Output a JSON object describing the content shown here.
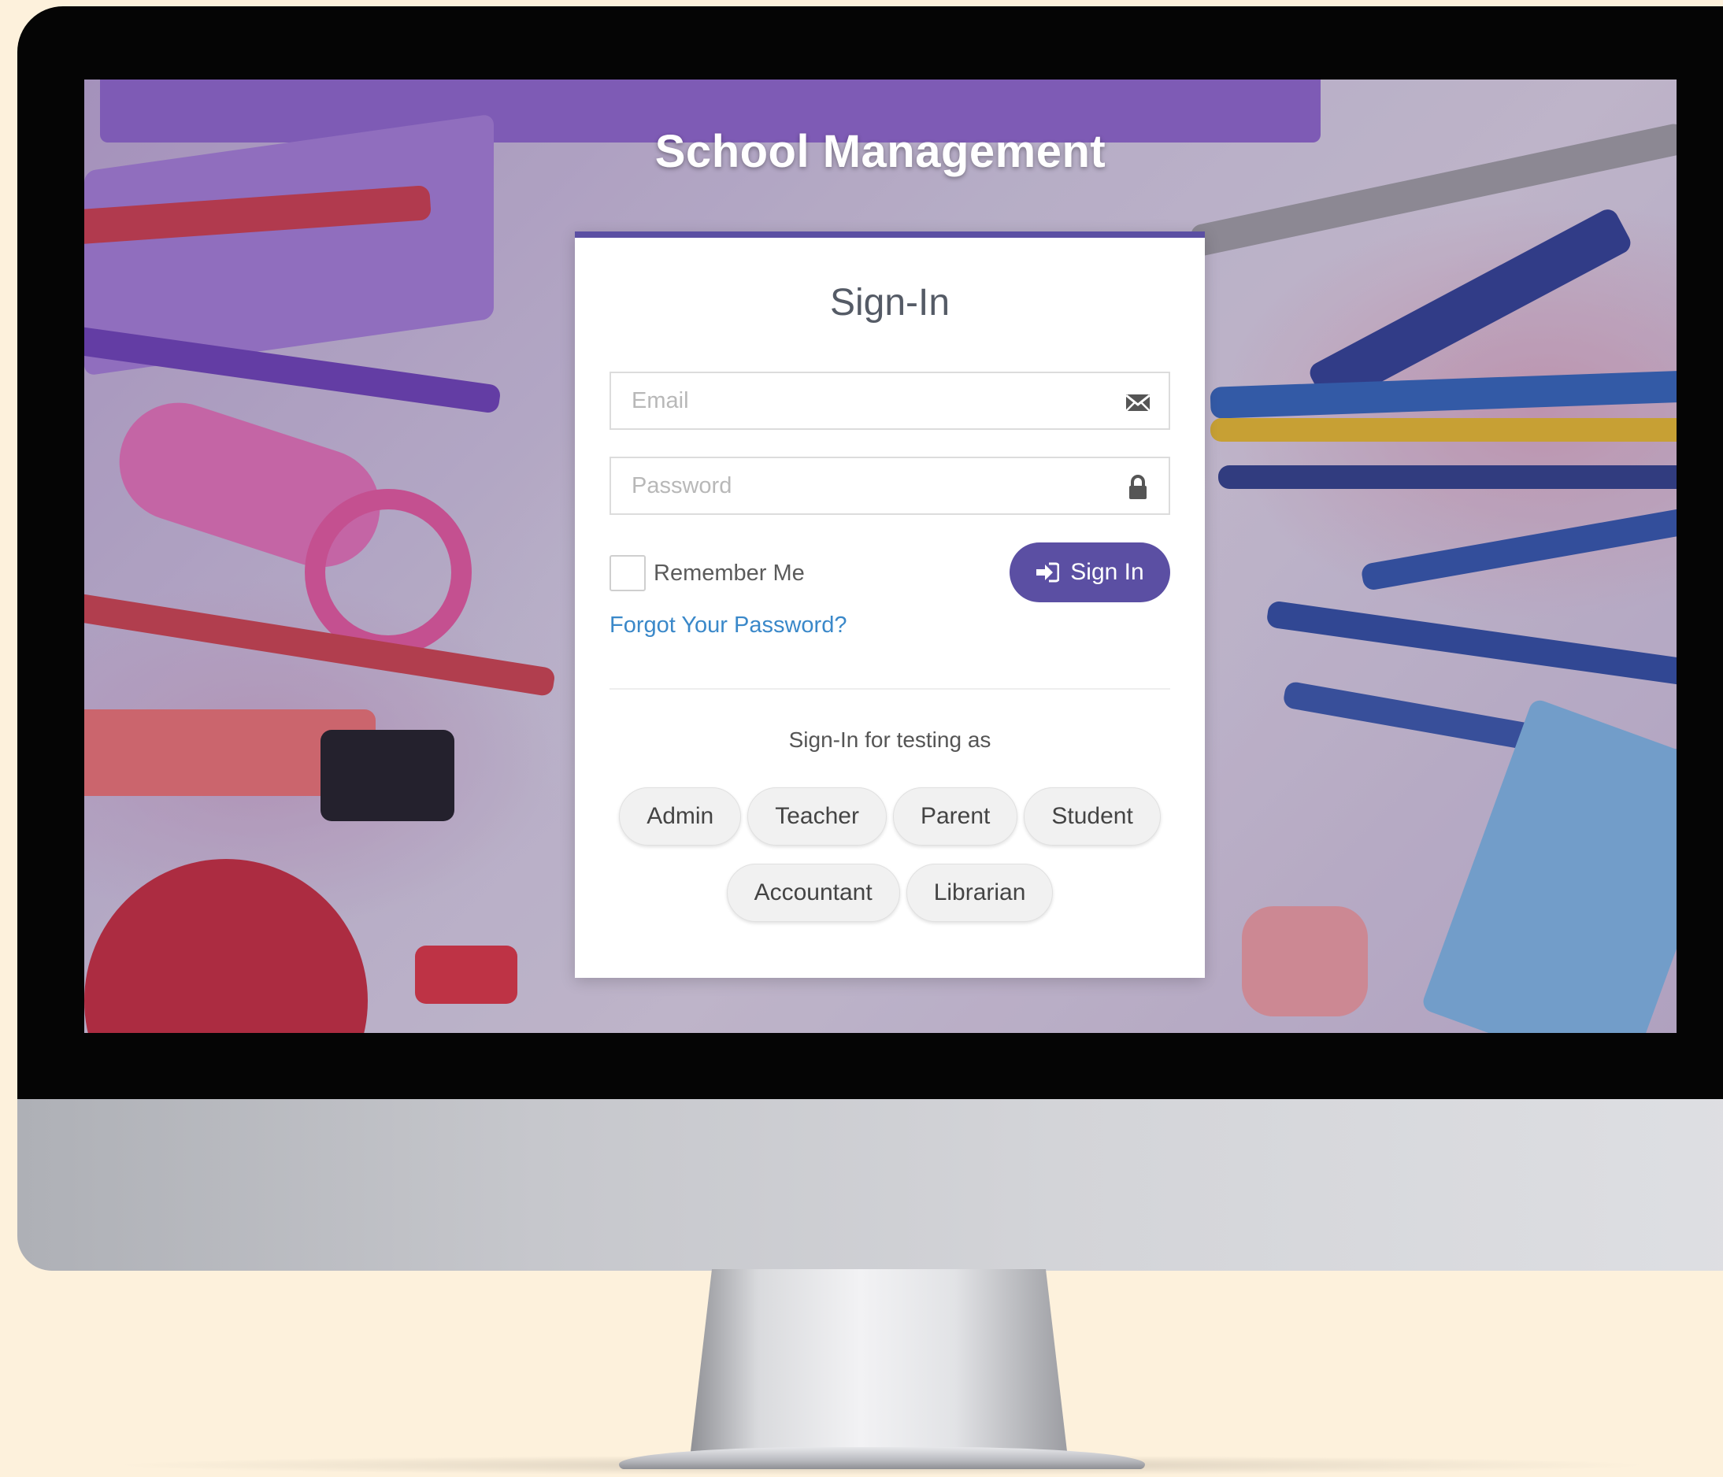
{
  "app": {
    "title": "School Management"
  },
  "login": {
    "title": "Sign-In",
    "email": {
      "value": "",
      "placeholder": "Email",
      "icon": "envelope-icon"
    },
    "password": {
      "value": "",
      "placeholder": "Password",
      "icon": "lock-icon"
    },
    "remember_label": "Remember Me",
    "remember_checked": false,
    "signin_label": "Sign In",
    "signin_icon": "sign-in-icon",
    "forgot_label": "Forgot Your Password?",
    "testing_label": "Sign-In for testing as",
    "roles_row1": [
      "Admin",
      "Teacher",
      "Parent",
      "Student"
    ],
    "roles_row2": [
      "Accountant",
      "Librarian"
    ]
  },
  "colors": {
    "accent": "#5b4fa3",
    "link": "#3a88c9",
    "page_background": "#fdf1dc"
  }
}
